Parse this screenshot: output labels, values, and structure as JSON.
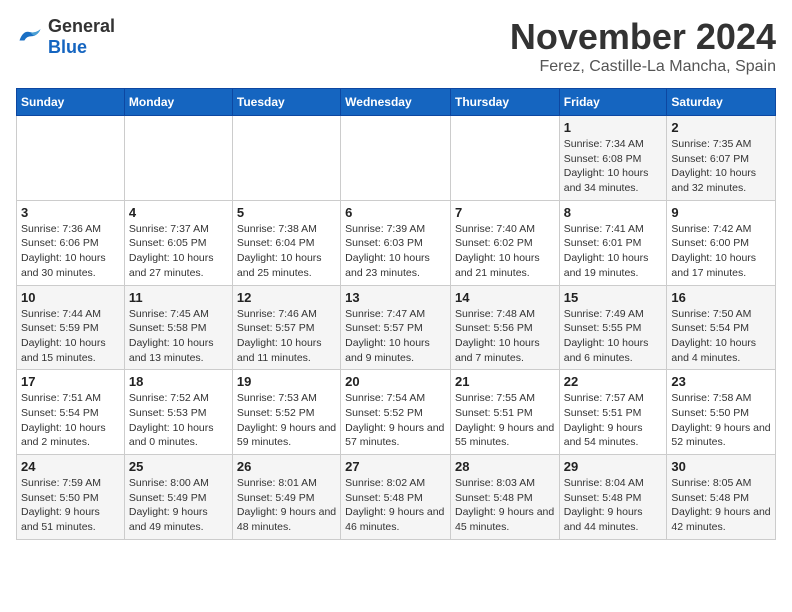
{
  "logo": {
    "general": "General",
    "blue": "Blue"
  },
  "title": "November 2024",
  "location": "Ferez, Castille-La Mancha, Spain",
  "weekdays": [
    "Sunday",
    "Monday",
    "Tuesday",
    "Wednesday",
    "Thursday",
    "Friday",
    "Saturday"
  ],
  "weeks": [
    [
      {
        "day": "",
        "info": ""
      },
      {
        "day": "",
        "info": ""
      },
      {
        "day": "",
        "info": ""
      },
      {
        "day": "",
        "info": ""
      },
      {
        "day": "",
        "info": ""
      },
      {
        "day": "1",
        "info": "Sunrise: 7:34 AM\nSunset: 6:08 PM\nDaylight: 10 hours and 34 minutes."
      },
      {
        "day": "2",
        "info": "Sunrise: 7:35 AM\nSunset: 6:07 PM\nDaylight: 10 hours and 32 minutes."
      }
    ],
    [
      {
        "day": "3",
        "info": "Sunrise: 7:36 AM\nSunset: 6:06 PM\nDaylight: 10 hours and 30 minutes."
      },
      {
        "day": "4",
        "info": "Sunrise: 7:37 AM\nSunset: 6:05 PM\nDaylight: 10 hours and 27 minutes."
      },
      {
        "day": "5",
        "info": "Sunrise: 7:38 AM\nSunset: 6:04 PM\nDaylight: 10 hours and 25 minutes."
      },
      {
        "day": "6",
        "info": "Sunrise: 7:39 AM\nSunset: 6:03 PM\nDaylight: 10 hours and 23 minutes."
      },
      {
        "day": "7",
        "info": "Sunrise: 7:40 AM\nSunset: 6:02 PM\nDaylight: 10 hours and 21 minutes."
      },
      {
        "day": "8",
        "info": "Sunrise: 7:41 AM\nSunset: 6:01 PM\nDaylight: 10 hours and 19 minutes."
      },
      {
        "day": "9",
        "info": "Sunrise: 7:42 AM\nSunset: 6:00 PM\nDaylight: 10 hours and 17 minutes."
      }
    ],
    [
      {
        "day": "10",
        "info": "Sunrise: 7:44 AM\nSunset: 5:59 PM\nDaylight: 10 hours and 15 minutes."
      },
      {
        "day": "11",
        "info": "Sunrise: 7:45 AM\nSunset: 5:58 PM\nDaylight: 10 hours and 13 minutes."
      },
      {
        "day": "12",
        "info": "Sunrise: 7:46 AM\nSunset: 5:57 PM\nDaylight: 10 hours and 11 minutes."
      },
      {
        "day": "13",
        "info": "Sunrise: 7:47 AM\nSunset: 5:57 PM\nDaylight: 10 hours and 9 minutes."
      },
      {
        "day": "14",
        "info": "Sunrise: 7:48 AM\nSunset: 5:56 PM\nDaylight: 10 hours and 7 minutes."
      },
      {
        "day": "15",
        "info": "Sunrise: 7:49 AM\nSunset: 5:55 PM\nDaylight: 10 hours and 6 minutes."
      },
      {
        "day": "16",
        "info": "Sunrise: 7:50 AM\nSunset: 5:54 PM\nDaylight: 10 hours and 4 minutes."
      }
    ],
    [
      {
        "day": "17",
        "info": "Sunrise: 7:51 AM\nSunset: 5:54 PM\nDaylight: 10 hours and 2 minutes."
      },
      {
        "day": "18",
        "info": "Sunrise: 7:52 AM\nSunset: 5:53 PM\nDaylight: 10 hours and 0 minutes."
      },
      {
        "day": "19",
        "info": "Sunrise: 7:53 AM\nSunset: 5:52 PM\nDaylight: 9 hours and 59 minutes."
      },
      {
        "day": "20",
        "info": "Sunrise: 7:54 AM\nSunset: 5:52 PM\nDaylight: 9 hours and 57 minutes."
      },
      {
        "day": "21",
        "info": "Sunrise: 7:55 AM\nSunset: 5:51 PM\nDaylight: 9 hours and 55 minutes."
      },
      {
        "day": "22",
        "info": "Sunrise: 7:57 AM\nSunset: 5:51 PM\nDaylight: 9 hours and 54 minutes."
      },
      {
        "day": "23",
        "info": "Sunrise: 7:58 AM\nSunset: 5:50 PM\nDaylight: 9 hours and 52 minutes."
      }
    ],
    [
      {
        "day": "24",
        "info": "Sunrise: 7:59 AM\nSunset: 5:50 PM\nDaylight: 9 hours and 51 minutes."
      },
      {
        "day": "25",
        "info": "Sunrise: 8:00 AM\nSunset: 5:49 PM\nDaylight: 9 hours and 49 minutes."
      },
      {
        "day": "26",
        "info": "Sunrise: 8:01 AM\nSunset: 5:49 PM\nDaylight: 9 hours and 48 minutes."
      },
      {
        "day": "27",
        "info": "Sunrise: 8:02 AM\nSunset: 5:48 PM\nDaylight: 9 hours and 46 minutes."
      },
      {
        "day": "28",
        "info": "Sunrise: 8:03 AM\nSunset: 5:48 PM\nDaylight: 9 hours and 45 minutes."
      },
      {
        "day": "29",
        "info": "Sunrise: 8:04 AM\nSunset: 5:48 PM\nDaylight: 9 hours and 44 minutes."
      },
      {
        "day": "30",
        "info": "Sunrise: 8:05 AM\nSunset: 5:48 PM\nDaylight: 9 hours and 42 minutes."
      }
    ]
  ]
}
